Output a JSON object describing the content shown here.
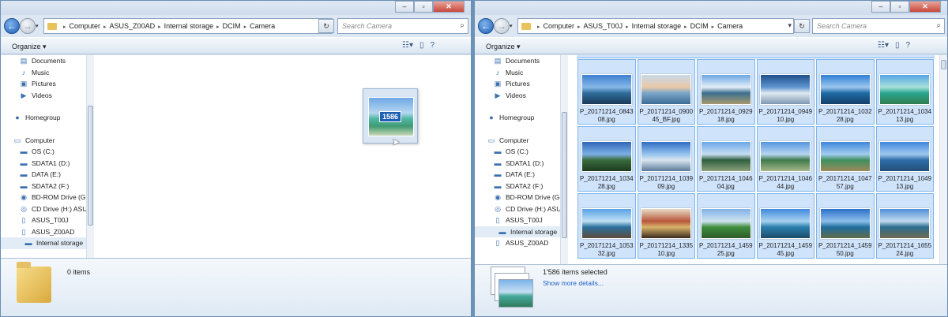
{
  "colors": {
    "accent": "#1e5fb3",
    "selection_bg": "#cfe3fb",
    "selection_border": "#7eb4ea",
    "link": "#1e5fc7"
  },
  "left_window": {
    "breadcrumb": [
      "Computer",
      "ASUS_Z00AD",
      "Internal storage",
      "DCIM",
      "Camera"
    ],
    "search_placeholder": "Search Camera",
    "toolbar": {
      "organize_label": "Organize"
    },
    "nav": [
      {
        "label": "Documents",
        "icon": "document-icon"
      },
      {
        "label": "Music",
        "icon": "music-icon"
      },
      {
        "label": "Pictures",
        "icon": "pictures-icon"
      },
      {
        "label": "Videos",
        "icon": "videos-icon"
      },
      {
        "label": "Homegroup",
        "icon": "homegroup-icon"
      },
      {
        "label": "Computer",
        "icon": "computer-icon"
      },
      {
        "label": "OS (C:)",
        "icon": "drive-icon"
      },
      {
        "label": "SDATA1 (D:)",
        "icon": "drive-icon"
      },
      {
        "label": "DATA (E:)",
        "icon": "drive-icon"
      },
      {
        "label": "SDATA2 (F:)",
        "icon": "drive-icon"
      },
      {
        "label": "BD-ROM Drive (G:",
        "icon": "disc-icon"
      },
      {
        "label": "CD Drive (H:) ASU",
        "icon": "cd-drive-icon"
      },
      {
        "label": "ASUS_T00J",
        "icon": "phone-icon"
      },
      {
        "label": "ASUS_Z00AD",
        "icon": "phone-icon"
      },
      {
        "label": "Internal storage",
        "icon": "storage-icon"
      }
    ],
    "drag_count": "1586",
    "status": {
      "items": "0 items"
    }
  },
  "right_window": {
    "breadcrumb": [
      "Computer",
      "ASUS_T00J",
      "Internal storage",
      "DCIM",
      "Camera"
    ],
    "search_placeholder": "Search Camera",
    "toolbar": {
      "organize_label": "Organize"
    },
    "nav": [
      {
        "label": "Documents",
        "icon": "document-icon"
      },
      {
        "label": "Music",
        "icon": "music-icon"
      },
      {
        "label": "Pictures",
        "icon": "pictures-icon"
      },
      {
        "label": "Videos",
        "icon": "videos-icon"
      },
      {
        "label": "Homegroup",
        "icon": "homegroup-icon"
      },
      {
        "label": "Computer",
        "icon": "computer-icon"
      },
      {
        "label": "OS (C:)",
        "icon": "drive-icon"
      },
      {
        "label": "SDATA1 (D:)",
        "icon": "drive-icon"
      },
      {
        "label": "DATA (E:)",
        "icon": "drive-icon"
      },
      {
        "label": "SDATA2 (F:)",
        "icon": "drive-icon"
      },
      {
        "label": "BD-ROM Drive (G:",
        "icon": "disc-icon"
      },
      {
        "label": "CD Drive (H:) ASU",
        "icon": "cd-drive-icon"
      },
      {
        "label": "ASUS_T00J",
        "icon": "phone-icon"
      },
      {
        "label": "Internal storage",
        "icon": "storage-icon"
      },
      {
        "label": "ASUS_Z00AD",
        "icon": "phone-icon"
      }
    ],
    "files": [
      "P_20171214_084308.jpg",
      "P_20171214_090045_BF.jpg",
      "P_20171214_092918.jpg",
      "P_20171214_094910.jpg",
      "P_20171214_103228.jpg",
      "P_20171214_103413.jpg",
      "P_20171214_103428.jpg",
      "P_20171214_103909.jpg",
      "P_20171214_104604.jpg",
      "P_20171214_104644.jpg",
      "P_20171214_104757.jpg",
      "P_20171214_104913.jpg",
      "P_20171214_105332.jpg",
      "P_20171214_133510.jpg",
      "P_20171214_145925.jpg",
      "P_20171214_145945.jpg",
      "P_20171214_145950.jpg",
      "P_20171214_165524.jpg"
    ],
    "status": {
      "selected": "1'586 items selected",
      "more_details": "Show more details..."
    }
  }
}
